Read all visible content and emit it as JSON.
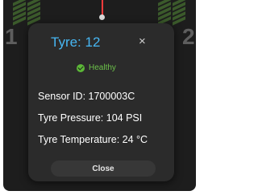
{
  "background": {
    "left_tyre_number": "1",
    "right_tyre_number": "2"
  },
  "dialog": {
    "title": "Tyre: 12",
    "close_icon": "×",
    "status": "Healthy",
    "sensor_id": "Sensor ID: 1700003C",
    "pressure": "Tyre Pressure: 104 PSI",
    "temperature": "Tyre Temperature: 24 °C",
    "close_button": "Close"
  },
  "colors": {
    "accent": "#47b6f2",
    "healthy": "#6cc24a",
    "pin": "#ff3b3b"
  },
  "icons": {
    "status": "check-circle-icon",
    "close": "close-icon"
  }
}
